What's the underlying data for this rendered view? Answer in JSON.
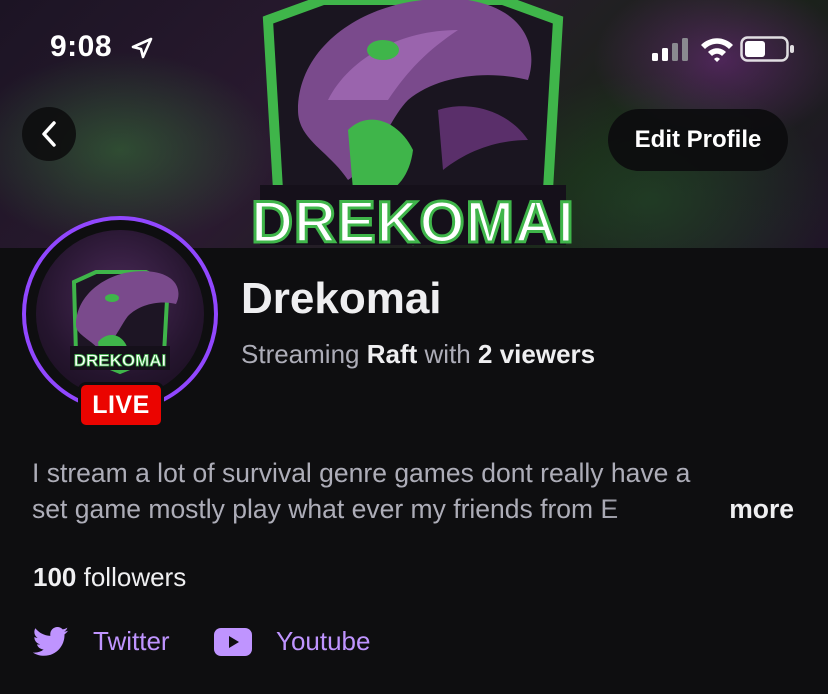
{
  "status_bar": {
    "time": "9:08"
  },
  "banner": {
    "logo_text": "DREKOMAI"
  },
  "header": {
    "edit_profile_label": "Edit Profile"
  },
  "avatar": {
    "logo_text": "DREKOMAI",
    "live_label": "LIVE"
  },
  "channel": {
    "name": "Drekomai",
    "streaming_prefix": "Streaming",
    "game": "Raft",
    "with_word": "with",
    "viewers": "2 viewers"
  },
  "bio": {
    "line1": "I stream a lot of survival genre games dont really have a",
    "line2": "set game mostly play what ever my friends from E",
    "more_label": "more"
  },
  "followers": {
    "count": "100",
    "label": "followers"
  },
  "social": [
    {
      "icon": "twitter-icon",
      "label": "Twitter"
    },
    {
      "icon": "youtube-icon",
      "label": "Youtube"
    }
  ],
  "colors": {
    "accent": "#9147ff",
    "link": "#bf94ff",
    "live": "#eb0400",
    "background": "#0e0e10"
  }
}
